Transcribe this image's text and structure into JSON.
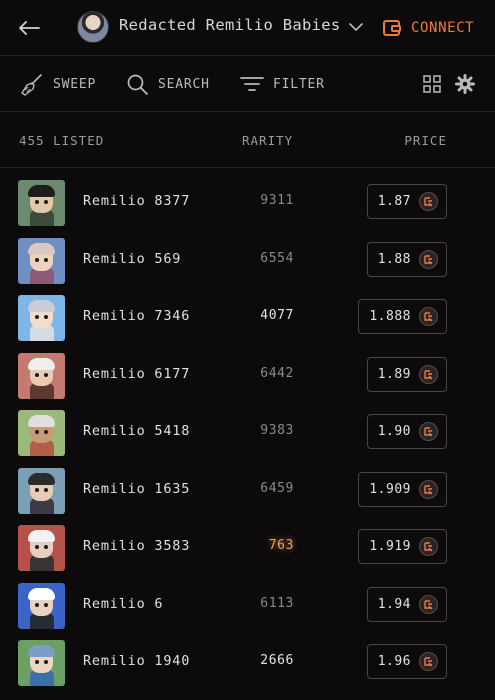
{
  "header": {
    "collection_title": "Redacted Remilio Babies",
    "connect_label": "CONNECT",
    "accent_color": "#ef7a3a"
  },
  "toolbar": {
    "sweep_label": "SWEEP",
    "search_label": "SEARCH",
    "filter_label": "FILTER"
  },
  "columns": {
    "listed": "455 LISTED",
    "rarity": "RARITY",
    "price": "PRICE"
  },
  "rows": [
    {
      "name": "Remilio 8377",
      "rarity": "9311",
      "price": "1.87",
      "style": "normal",
      "colors": [
        "#6c8a6f",
        "#3b4a3a",
        "#e3c8a8",
        "#1d1d1d"
      ]
    },
    {
      "name": "Remilio 569",
      "rarity": "6554",
      "price": "1.88",
      "style": "normal",
      "colors": [
        "#6f8fc2",
        "#8d5a77",
        "#efd2bd",
        "#d9c9c2"
      ]
    },
    {
      "name": "Remilio 7346",
      "rarity": "4077",
      "price": "1.888",
      "style": "hi",
      "colors": [
        "#7fb6e8",
        "#d7dbe3",
        "#f1dccd",
        "#c9cdd6"
      ]
    },
    {
      "name": "Remilio 6177",
      "rarity": "6442",
      "price": "1.89",
      "style": "normal",
      "colors": [
        "#c27b6e",
        "#5d3a31",
        "#e9cbb4",
        "#eeeeee"
      ]
    },
    {
      "name": "Remilio 5418",
      "rarity": "9383",
      "price": "1.90",
      "style": "normal",
      "colors": [
        "#9cb97c",
        "#b25f48",
        "#c99a77",
        "#e0dfe0"
      ]
    },
    {
      "name": "Remilio 1635",
      "rarity": "6459",
      "price": "1.909",
      "style": "normal",
      "colors": [
        "#7aa0b5",
        "#3d3a45",
        "#e6cbb6",
        "#2b2b2b"
      ]
    },
    {
      "name": "Remilio 3583",
      "rarity": "763",
      "price": "1.919",
      "style": "gold",
      "colors": [
        "#b7514c",
        "#393237",
        "#e7cfbf",
        "#f2f2f2"
      ]
    },
    {
      "name": "Remilio 6",
      "rarity": "6113",
      "price": "1.94",
      "style": "normal",
      "colors": [
        "#3b63c8",
        "#262a33",
        "#e8d2c0",
        "#ffffff"
      ]
    },
    {
      "name": "Remilio 1940",
      "rarity": "2666",
      "price": "1.96",
      "style": "hi",
      "colors": [
        "#6b9f63",
        "#3e6fa7",
        "#ecd5c3",
        "#7e9cc9"
      ]
    }
  ]
}
